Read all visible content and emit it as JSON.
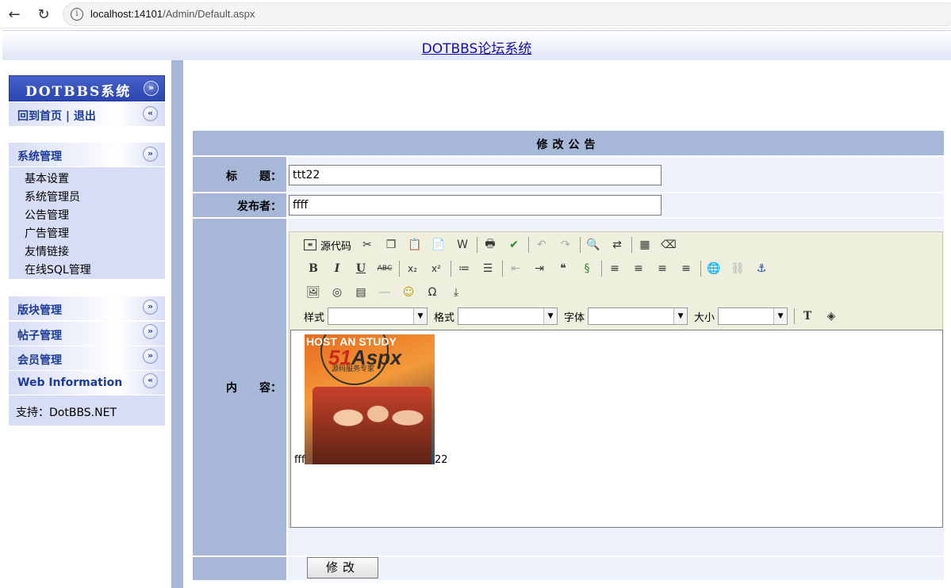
{
  "browser": {
    "url_host": "localhost:14101",
    "url_path": "/Admin/Default.aspx",
    "back_glyph": "←",
    "reload_glyph": "↻",
    "info_glyph": "i"
  },
  "header": {
    "site_link": "DOTBBS论坛系统"
  },
  "sidebar": {
    "system_title": "DOTBBS系统",
    "home_logout": "回到首页 | 退出",
    "sections": [
      {
        "label": "系统管理",
        "items": [
          "基本设置",
          "系统管理员",
          "公告管理",
          "广告管理",
          "友情链接",
          "在线SQL管理"
        ]
      },
      {
        "label": "版块管理"
      },
      {
        "label": "帖子管理"
      },
      {
        "label": "会员管理"
      },
      {
        "label": "Web Information"
      }
    ],
    "support": "支持：DotBBS.NET",
    "expand_glyph": "»",
    "collapse_glyph": "«"
  },
  "form": {
    "title": "修改公告",
    "title_label": "标　　题：",
    "title_value": "ttt22",
    "publisher_label": "发布者：",
    "publisher_value": "ffff",
    "content_label": "内　　容：",
    "submit_label": "修改"
  },
  "editor": {
    "source_label": "源代码",
    "style_label": "样式",
    "format_label": "格式",
    "font_label": "字体",
    "size_label": "大小",
    "dropdown_glyph": "▼",
    "content_before": "fff",
    "content_after": "22",
    "image_banner": "HOST AN STUDY",
    "image_logo": "Aspx",
    "image_sub": "源码服务专家",
    "image_logo_prefix": "51",
    "glyphs": {
      "cut": "✂",
      "copy": "❐",
      "paste": "📋",
      "paste_text": "📄",
      "paste_word": "W",
      "print": "🖶",
      "spellcheck": "✔",
      "undo": "↶",
      "redo": "↷",
      "find": "🔍",
      "replace": "⇄",
      "select_all": "▦",
      "remove_format": "⌫",
      "bold": "B",
      "italic": "I",
      "underline": "U",
      "strike": "ABC",
      "subscript": "x₂",
      "superscript": "x²",
      "ordered_list": "≔",
      "unordered_list": "☰",
      "outdent": "⇤",
      "indent": "⇥",
      "blockquote": "❝",
      "div": "§",
      "align_left": "≡",
      "align_center": "≡",
      "align_right": "≡",
      "justify": "≡",
      "link": "🌐",
      "unlink": "⛓",
      "anchor": "⚓",
      "image": "🖼",
      "flash": "◎",
      "table": "▤",
      "hr": "―",
      "smiley": "☺",
      "special_char": "Ω",
      "page_break": "⤓",
      "text_color": "T",
      "bg_color": "◈"
    }
  }
}
